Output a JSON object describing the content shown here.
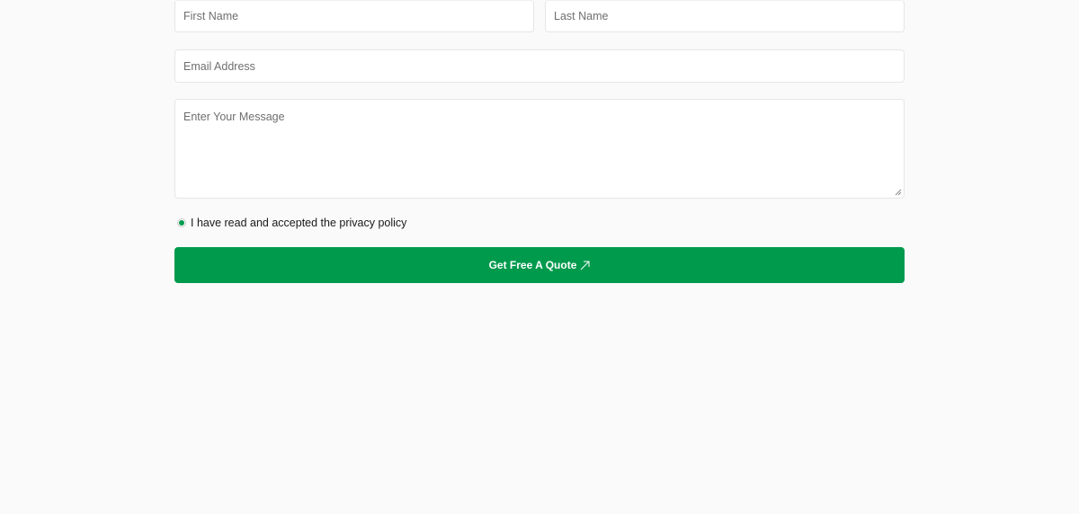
{
  "form": {
    "first_name_placeholder": "First Name",
    "last_name_placeholder": "Last Name",
    "email_placeholder": "Email Address",
    "message_placeholder": "Enter Your Message",
    "consent_label": "I have read and accepted the privacy policy",
    "consent_checked": true,
    "submit_label": "Get Free A Quote",
    "submit_icon": "arrow-up-right-icon"
  },
  "colors": {
    "accent": "#009a4d",
    "background": "#fafafa",
    "field_border": "#e6e6e6",
    "placeholder_text": "#6f6f6f"
  }
}
